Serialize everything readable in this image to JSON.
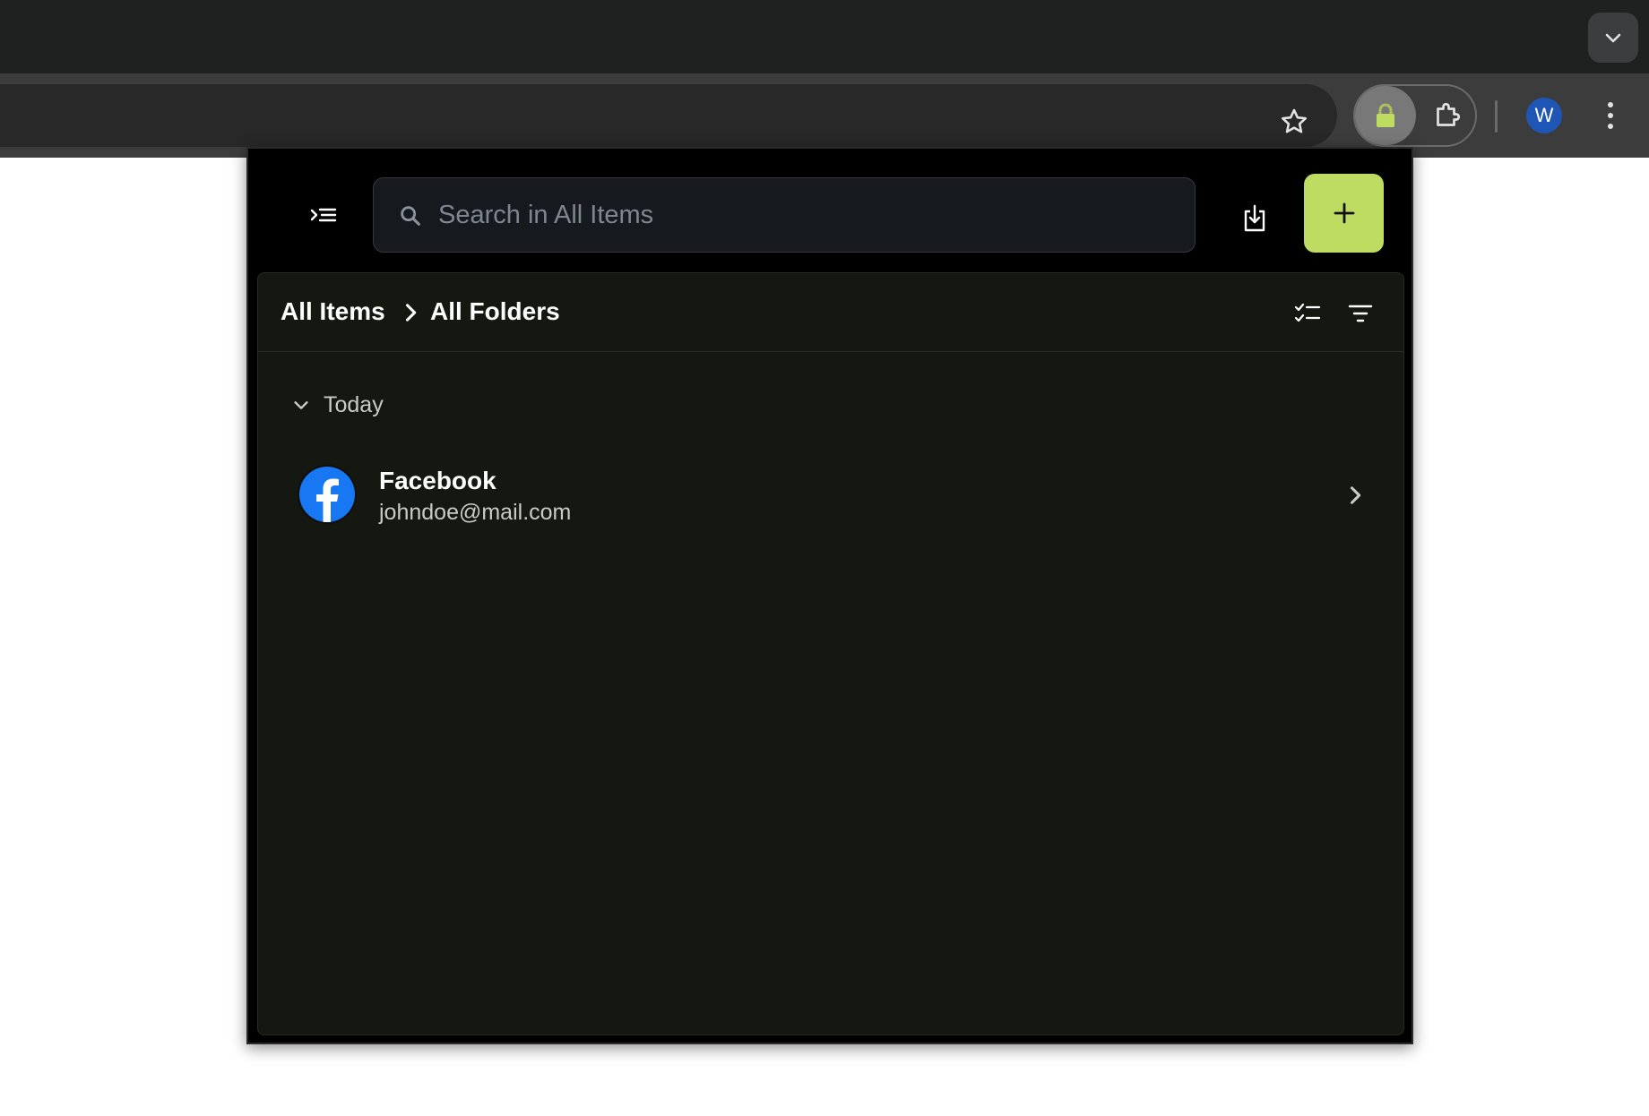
{
  "browser": {
    "profile_initial": "W",
    "icons": {
      "tab_search": "chevron-down-icon",
      "bookmark": "star-icon",
      "extension_active": "lock-icon",
      "extensions": "puzzle-icon",
      "menu": "more-vertical-icon"
    }
  },
  "popup": {
    "search": {
      "placeholder": "Search in All Items",
      "value": ""
    },
    "breadcrumb": {
      "root": "All Items",
      "current": "All Folders"
    },
    "groups": [
      {
        "label": "Today",
        "items": [
          {
            "title": "Facebook",
            "subtitle": "johndoe@mail.com",
            "logo": "facebook-icon"
          }
        ]
      }
    ],
    "icons": {
      "menu": "menu-collapse-icon",
      "search": "search-icon",
      "import": "import-icon",
      "add": "plus-icon",
      "multi_select": "checklist-icon",
      "sort": "filter-icon"
    }
  },
  "colors": {
    "accent": "#bfdc62",
    "popup_background": "#000000",
    "panel_background": "#151811",
    "profile_avatar": "#1f56b6",
    "facebook": "#1877f2"
  }
}
